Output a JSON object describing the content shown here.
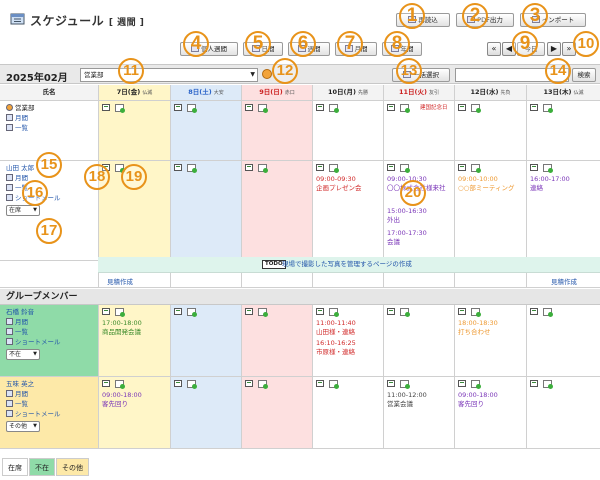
{
  "app": {
    "title": "スケジュール",
    "subtitle": "[ 週間 ]"
  },
  "toolbar": {
    "reload_label": "再読込",
    "pdf_label": "PDF出力",
    "import_label": "インポート",
    "view_personal_week": "個人週間",
    "view_day": "日間",
    "view_week": "週間",
    "view_month": "月間",
    "view_year": "年間",
    "nav_first": "«",
    "nav_prev": "◀",
    "nav_today": "今日",
    "nav_next": "▶",
    "nav_last": "»",
    "group_select_btn": "一括選択",
    "search_btn": "検索",
    "search_placeholder": ""
  },
  "filter": {
    "month": "2025年02月",
    "group": "営業部"
  },
  "columns": {
    "name_header": "氏名",
    "days": [
      {
        "label": "7日(金)",
        "rokuyo": "仏滅",
        "kind": "fri"
      },
      {
        "label": "8日(土)",
        "rokuyo": "大安",
        "kind": "sat"
      },
      {
        "label": "9日(日)",
        "rokuyo": "赤口",
        "kind": "sun"
      },
      {
        "label": "10日(月)",
        "rokuyo": "先勝",
        "kind": "normal"
      },
      {
        "label": "11日(火)",
        "rokuyo": "友引",
        "kind": "holiday"
      },
      {
        "label": "12日(水)",
        "rokuyo": "先負",
        "kind": "normal"
      },
      {
        "label": "13日(木)",
        "rokuyo": "仏滅",
        "kind": "normal"
      }
    ]
  },
  "department": {
    "name": "営業部",
    "links": [
      "月間",
      "一覧"
    ]
  },
  "holiday_label": "建国記念日",
  "user": {
    "name": "山田 太郎",
    "links": [
      "月間",
      "一覧",
      "ショートメール"
    ],
    "status": "在席"
  },
  "user_events": {
    "d10": {
      "time": "09:00-09:30",
      "title": "企画プレゼン会"
    },
    "d11": [
      {
        "time": "09:00-10:30",
        "title": "〇〇株式会社様来社"
      },
      {
        "time": "15:00-16:30",
        "title": "外出"
      },
      {
        "time": "17:00-17:30",
        "title": "会議"
      }
    ],
    "d12": {
      "time": "09:00-10:00",
      "title": "○○部ミーティング"
    },
    "d13": {
      "time": "16:00-17:00",
      "title": "連絡"
    }
  },
  "todo": {
    "tag": "TODO",
    "text": "現場で撮影した写真を管理するページの作成",
    "task_fri": "見積作成",
    "task_thu": "見積作成"
  },
  "group_members_title": "グループメンバー",
  "members": [
    {
      "name": "石橋 鈴音",
      "links": [
        "月間",
        "一覧",
        "ショートメール"
      ],
      "status": "不在",
      "ev_fri": {
        "time": "17:00-18:00",
        "title": "商品開発会議"
      },
      "ev_mon": [
        {
          "time": "11:00-11:40",
          "title": "山田様・連絡"
        },
        {
          "time": "16:10-16:25",
          "title": "市原様・連絡"
        }
      ],
      "ev_wed": {
        "time": "18:00-18:30",
        "title": "打ち合わせ"
      }
    },
    {
      "name": "五味 英之",
      "links": [
        "月間",
        "一覧",
        "ショートメール"
      ],
      "status": "その他",
      "ev_fri": {
        "time": "09:00-18:00",
        "title": "客先回り"
      },
      "ev_tue": {
        "time": "11:00-12:00",
        "title": "営業会議"
      },
      "ev_wed": {
        "time": "09:00-18:00",
        "title": "客先回り"
      }
    }
  ],
  "legend": [
    "在席",
    "不在",
    "その他"
  ],
  "callouts": [
    "1",
    "2",
    "3",
    "4",
    "5",
    "6",
    "7",
    "8",
    "9",
    "10",
    "11",
    "12",
    "13",
    "14",
    "15",
    "16",
    "17",
    "18",
    "19",
    "20"
  ],
  "colors": {
    "accent": "#e8931a",
    "present": "#ffffff",
    "absent": "#8fdba8",
    "other": "#fde9a8"
  }
}
